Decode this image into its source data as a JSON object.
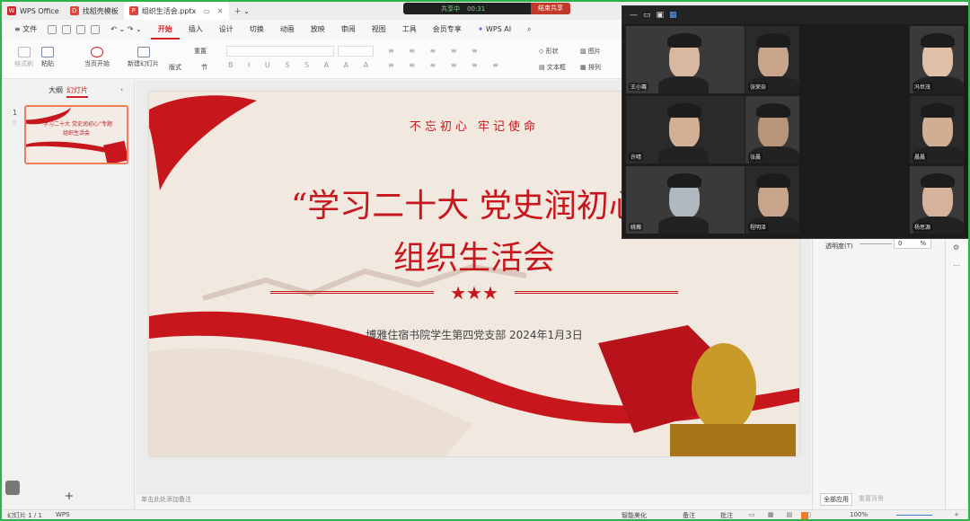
{
  "tabs": [
    {
      "label": "WPS Office",
      "color": "#d2232a"
    },
    {
      "label": "找稻壳模板",
      "color": "#e0453a"
    },
    {
      "label": "组织生活会.pptx",
      "color": "#e0453a"
    }
  ],
  "meeting": {
    "status": "共享中",
    "time": "00:31",
    "end": "结束共享"
  },
  "menu": {
    "file": "文件",
    "items": [
      "开始",
      "插入",
      "设计",
      "切换",
      "动画",
      "放映",
      "审阅",
      "视图",
      "工具",
      "会员专享"
    ],
    "ai": "WPS AI"
  },
  "ribbon": {
    "format_painter": "格式刷",
    "paste": "粘贴",
    "from_current": "当页开始",
    "new_slide": "新建幻灯片",
    "layout": "版式",
    "section": "节",
    "reset": "重置",
    "shape": "形状",
    "picture": "图片",
    "textbox": "文本框",
    "arrange": "排列"
  },
  "panel": {
    "outline_tab": "大纲",
    "slides_tab": "幻灯片",
    "slide_number": "1",
    "add": "+"
  },
  "slide": {
    "motto": "不忘初心 牢记使命",
    "title_line1": "“学习二十大 党史润初心”",
    "title_line2": "组织生活会",
    "stars": "★★★",
    "footer": "博雅住宿书院学生第四党支部  2024年1月3日"
  },
  "thumbnail": {
    "title_line1": "“学习二十大 党史润初心”专题",
    "title_line2": "组织生活会"
  },
  "notes_placeholder": "单击此处添加备注",
  "right_panel": {
    "transparency_label": "透明度(T)",
    "transparency_value": "0",
    "unit": "%",
    "apply_all": "全部应用",
    "reset_bg": "重置背景"
  },
  "participants": [
    "王小骞",
    "张荣奈",
    "冯世茂",
    "许晴",
    "张晨",
    "晨晨",
    "姚薇",
    "程明泽",
    "杨思源"
  ],
  "status": {
    "slide_count": "幻灯片 1 / 1",
    "wps": "WPS",
    "smart_beautify": "智能美化",
    "notes": "备注",
    "comments": "批注",
    "zoom": "100%"
  }
}
